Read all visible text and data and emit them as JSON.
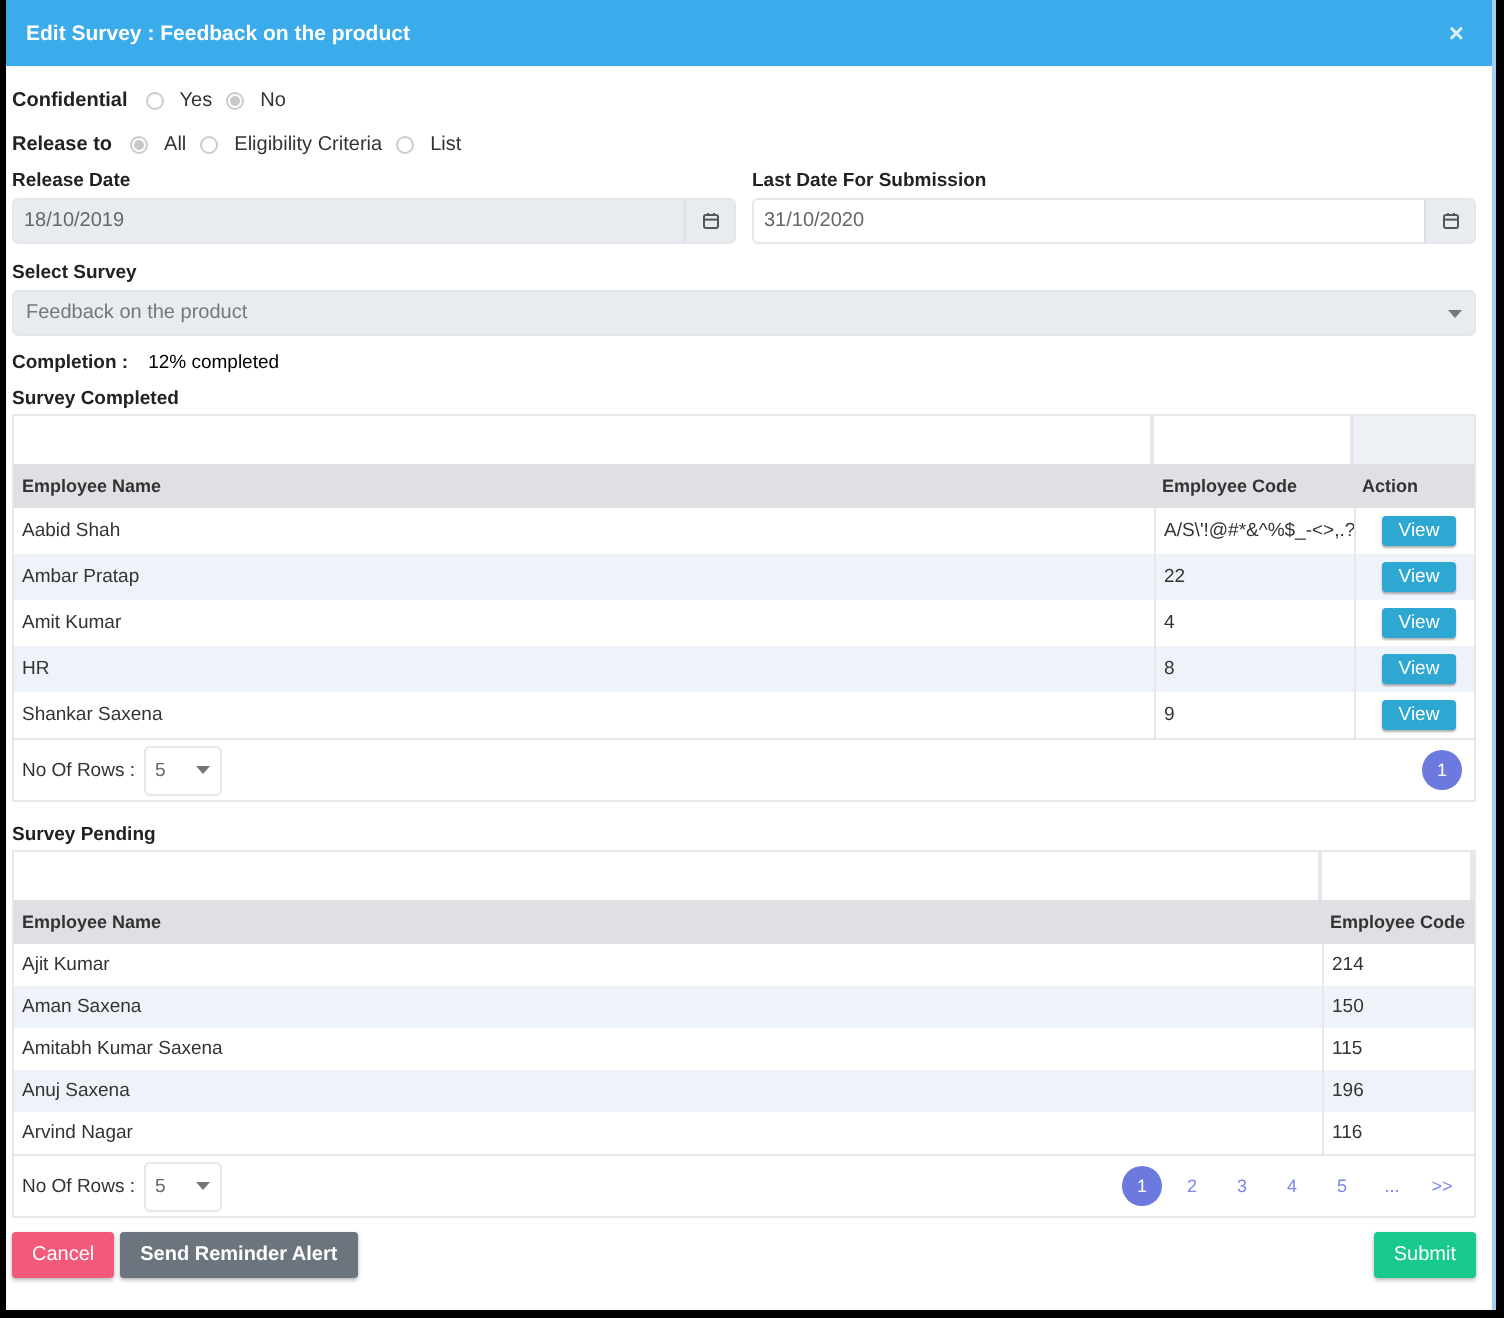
{
  "window": {
    "title": "Edit Survey : Feedback on the product",
    "close": "×"
  },
  "confidential": {
    "label": "Confidential",
    "options": [
      {
        "label": "Yes",
        "selected": false
      },
      {
        "label": "No",
        "selected": true
      }
    ]
  },
  "release_to": {
    "label": "Release to",
    "options": [
      {
        "label": "All",
        "selected": true
      },
      {
        "label": "Eligibility Criteria",
        "selected": false
      },
      {
        "label": "List",
        "selected": false
      }
    ]
  },
  "release_date": {
    "label": "Release Date",
    "value": "18/10/2019",
    "disabled": true
  },
  "last_date": {
    "label": "Last Date For Submission",
    "value": "31/10/2020",
    "disabled": false
  },
  "select_survey": {
    "label": "Select Survey",
    "value": "Feedback on the product",
    "disabled": true
  },
  "completion": {
    "label": "Completion :",
    "value": "12% completed"
  },
  "survey_completed": {
    "title": "Survey Completed",
    "columns": [
      "Employee Name",
      "Employee Code",
      "Action"
    ],
    "rows": [
      {
        "name": "Aabid Shah",
        "code": "A/S\\'!@#*&^%$_-<>,.?",
        "action": "View"
      },
      {
        "name": "Ambar Pratap",
        "code": "22",
        "action": "View"
      },
      {
        "name": "Amit Kumar",
        "code": "4",
        "action": "View"
      },
      {
        "name": "HR",
        "code": "8",
        "action": "View"
      },
      {
        "name": "Shankar Saxena",
        "code": "9",
        "action": "View"
      }
    ],
    "rows_per_page": {
      "label": "No Of Rows :",
      "value": "5"
    },
    "pages": [
      {
        "label": "1",
        "selected": true
      }
    ]
  },
  "survey_pending": {
    "title": "Survey Pending",
    "columns": [
      "Employee Name",
      "Employee Code"
    ],
    "rows": [
      {
        "name": "Ajit Kumar",
        "code": "214"
      },
      {
        "name": "Aman Saxena",
        "code": "150"
      },
      {
        "name": "Amitabh Kumar Saxena",
        "code": "115"
      },
      {
        "name": "Anuj Saxena",
        "code": "196"
      },
      {
        "name": "Arvind Nagar",
        "code": "116"
      }
    ],
    "rows_per_page": {
      "label": "No Of Rows :",
      "value": "5"
    },
    "pages": [
      {
        "label": "1",
        "selected": true
      },
      {
        "label": "2",
        "selected": false
      },
      {
        "label": "3",
        "selected": false
      },
      {
        "label": "4",
        "selected": false
      },
      {
        "label": "5",
        "selected": false
      },
      {
        "label": "...",
        "selected": false
      },
      {
        "label": ">>",
        "selected": false
      }
    ]
  },
  "buttons": [
    {
      "label": "Cancel",
      "kind": "danger"
    },
    {
      "label": "Send Reminder Alert",
      "kind": "secondary"
    },
    {
      "label": "Submit",
      "kind": "success"
    }
  ]
}
